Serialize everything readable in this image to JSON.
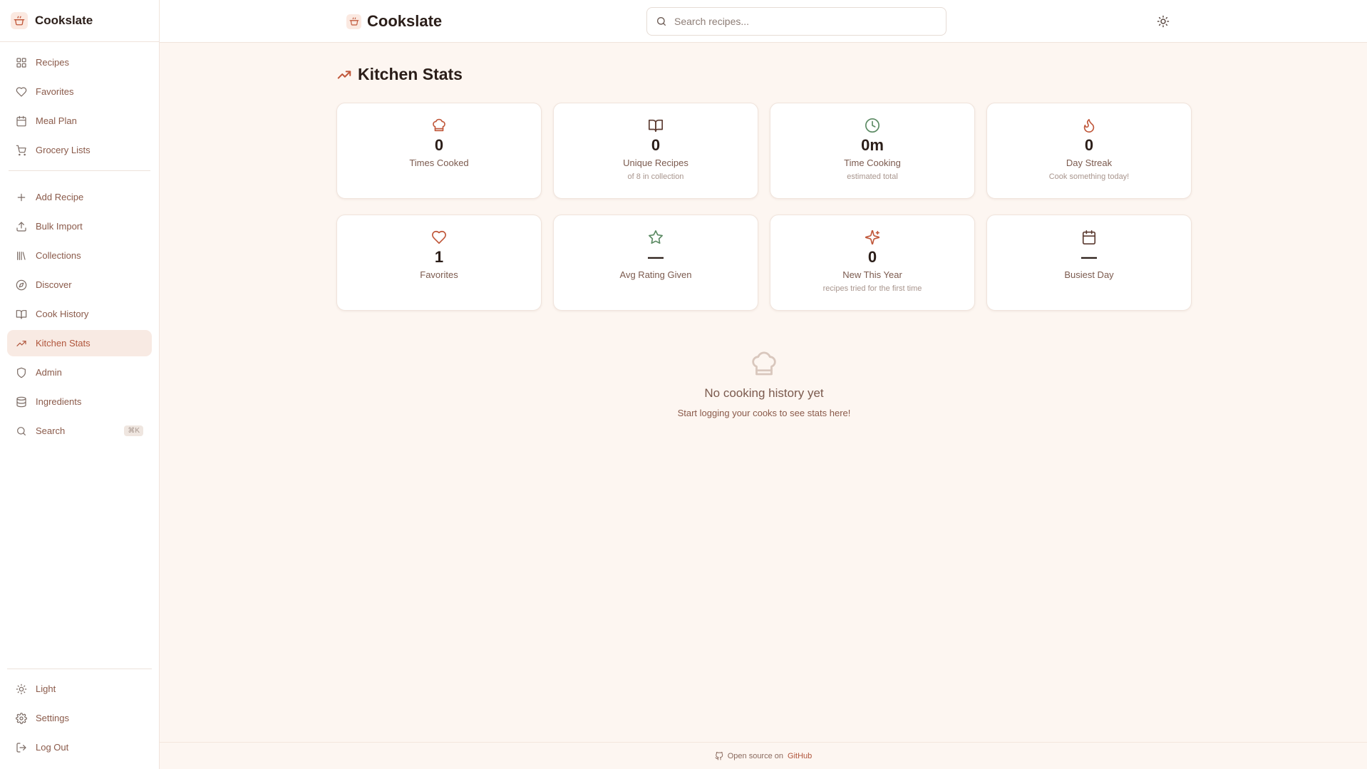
{
  "app": {
    "name": "Cookslate"
  },
  "sidebar": {
    "groups": [
      [
        {
          "label": "Recipes",
          "icon": "grid-icon"
        },
        {
          "label": "Favorites",
          "icon": "heart-icon"
        },
        {
          "label": "Meal Plan",
          "icon": "calendar-icon"
        },
        {
          "label": "Grocery Lists",
          "icon": "cart-icon"
        }
      ],
      [
        {
          "label": "Add Recipe",
          "icon": "plus-icon"
        },
        {
          "label": "Bulk Import",
          "icon": "upload-icon"
        },
        {
          "label": "Collections",
          "icon": "library-icon"
        },
        {
          "label": "Discover",
          "icon": "compass-icon"
        },
        {
          "label": "Cook History",
          "icon": "book-open-icon"
        },
        {
          "label": "Kitchen Stats",
          "icon": "trending-up-icon",
          "active": true
        },
        {
          "label": "Admin",
          "icon": "shield-icon"
        },
        {
          "label": "Ingredients",
          "icon": "database-icon"
        },
        {
          "label": "Search",
          "icon": "search-icon",
          "shortcut": "⌘K"
        }
      ]
    ],
    "bottom": [
      {
        "label": "Light",
        "icon": "sun-icon"
      },
      {
        "label": "Settings",
        "icon": "gear-icon"
      },
      {
        "label": "Log Out",
        "icon": "log-out-icon"
      }
    ]
  },
  "header": {
    "brand": "Cookslate",
    "search_placeholder": "Search recipes..."
  },
  "page": {
    "title": "Kitchen Stats"
  },
  "stats": [
    {
      "icon": "chef-hat-icon",
      "value": "0",
      "label": "Times Cooked",
      "sub": "",
      "color": "#c0573a"
    },
    {
      "icon": "book-open-icon",
      "value": "0",
      "label": "Unique Recipes",
      "sub": "of 8 in collection",
      "color": "#5b3a30"
    },
    {
      "icon": "clock-icon",
      "value": "0m",
      "label": "Time Cooking",
      "sub": "estimated total",
      "color": "#5b8a63"
    },
    {
      "icon": "flame-icon",
      "value": "0",
      "label": "Day Streak",
      "sub": "Cook something today!",
      "color": "#c0573a"
    },
    {
      "icon": "heart-icon",
      "value": "1",
      "label": "Favorites",
      "sub": "",
      "color": "#c0573a"
    },
    {
      "icon": "star-icon",
      "value": "—",
      "label": "Avg Rating Given",
      "sub": "",
      "color": "#5b8a63"
    },
    {
      "icon": "sparkles-icon",
      "value": "0",
      "label": "New This Year",
      "sub": "recipes tried for the first time",
      "color": "#c0573a"
    },
    {
      "icon": "calendar-icon",
      "value": "—",
      "label": "Busiest Day",
      "sub": "",
      "color": "#5b3a30"
    }
  ],
  "empty_state": {
    "title": "No cooking history yet",
    "description": "Start logging your cooks to see stats here!"
  },
  "footer": {
    "text": "Open source on",
    "link": "GitHub"
  },
  "colors": {
    "accent": "#b0563c",
    "background": "#fdf6f1",
    "active_bg": "#f8eae3"
  }
}
